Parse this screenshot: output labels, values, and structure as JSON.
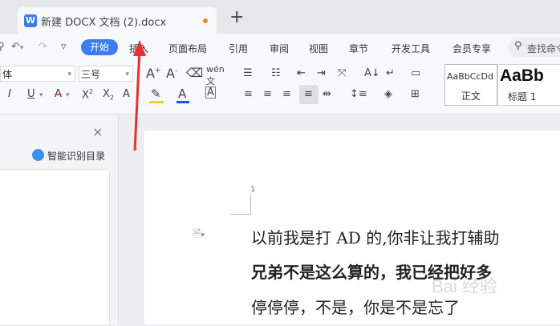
{
  "tab": {
    "icon": "W",
    "title": "新建 DOCX 文档 (2).docx",
    "new_tab": "+"
  },
  "menu": {
    "items": [
      "开始",
      "插入",
      "页面布局",
      "引用",
      "审阅",
      "视图",
      "章节",
      "开发工具",
      "会员专享"
    ],
    "active": "开始",
    "search": "查找命令"
  },
  "ribbon": {
    "font_name": "体",
    "font_size": "三号",
    "styles": [
      {
        "preview": "AaBbCcDd",
        "label": "正文"
      },
      {
        "preview": "AaBb",
        "label": "标题 1"
      }
    ]
  },
  "left_panel": {
    "close": "×",
    "smart_toc": "智能识别目录"
  },
  "document": {
    "page_number": "1",
    "lines": [
      "以前我是打 AD 的,你非让我打辅助",
      "兄弟不是这么算的，我已经把好多",
      "停停停，不是，你是不是忘了"
    ],
    "bold_line_index": 1
  },
  "watermark": "Bai 经验",
  "annotation": {
    "arrow_color": "#e8302e"
  },
  "colors": {
    "accent": "#3d7cf2",
    "font_color_bar": "#1a56d6",
    "highlight_bar": "#f2d21b",
    "strike_red": "#e0302e"
  }
}
